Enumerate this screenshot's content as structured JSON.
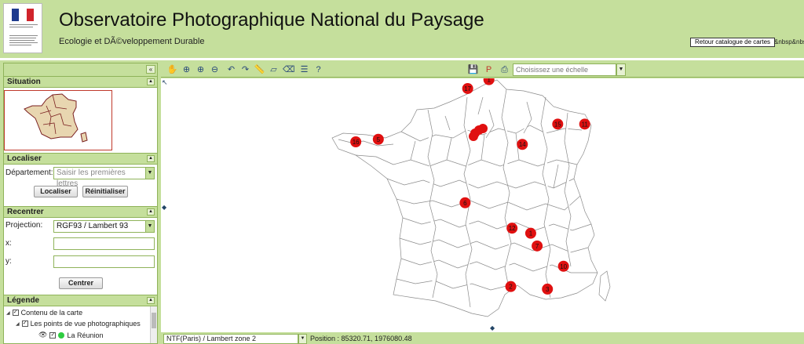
{
  "header": {
    "title": "Observatoire Photographique National du Paysage",
    "subtitle": "Ecologie et DÃ©veloppement Durable",
    "back_button": "Retour catalogue de cartes",
    "back_trail": "&nbsp&nbs",
    "logo_text": "RÉPUBLIQUE FRANÇAISE"
  },
  "panel": {
    "situation": {
      "title": "Situation"
    },
    "localiser": {
      "title": "Localiser",
      "departement_label": "Département:",
      "departement_placeholder": "Saisir les premières lettres",
      "localiser_button": "Localiser",
      "reset_button": "Réinitialiser"
    },
    "recentrer": {
      "title": "Recentrer",
      "projection_label": "Projection:",
      "projection_value": "RGF93 / Lambert 93",
      "x_label": "x:",
      "y_label": "y:",
      "center_button": "Centrer"
    },
    "legende": {
      "title": "Légende",
      "items": [
        "Contenu de la carte",
        "Les points de vue photographiques",
        "La Réunion"
      ]
    }
  },
  "toolbar": {
    "scale_placeholder": "Choisissez une échelle",
    "icons": [
      "pan-icon",
      "zoom-extent-icon",
      "zoom-in-icon",
      "zoom-out-icon",
      "previous-view-icon",
      "next-view-icon",
      "measure-distance-icon",
      "measure-area-icon",
      "clear-measure-icon",
      "legend-list-icon",
      "query-icon",
      "save-icon",
      "pdf-icon",
      "print-icon",
      "export-icon",
      "map-info-icon"
    ]
  },
  "map": {
    "markers": [
      {
        "label": "17",
        "x": 0.477,
        "y": 0.04
      },
      {
        "label": "1",
        "x": 0.51,
        "y": 0.005
      },
      {
        "label": "16",
        "x": 0.303,
        "y": 0.25
      },
      {
        "label": "5",
        "x": 0.338,
        "y": 0.24
      },
      {
        "label": "15",
        "x": 0.617,
        "y": 0.18
      },
      {
        "label": "11",
        "x": 0.659,
        "y": 0.18
      },
      {
        "label": "14",
        "x": 0.562,
        "y": 0.26
      },
      {
        "label": "6",
        "x": 0.473,
        "y": 0.49
      },
      {
        "label": "12",
        "x": 0.546,
        "y": 0.59
      },
      {
        "label": "1",
        "x": 0.575,
        "y": 0.61
      },
      {
        "label": "7",
        "x": 0.585,
        "y": 0.66
      },
      {
        "label": "10",
        "x": 0.626,
        "y": 0.74
      },
      {
        "label": "2",
        "x": 0.544,
        "y": 0.82
      },
      {
        "label": "3",
        "x": 0.601,
        "y": 0.83
      }
    ]
  },
  "status": {
    "projection": "NTF(Paris) / Lambert zone 2",
    "position": "Position : 85320.71, 1976080.48"
  },
  "colors": {
    "header_bg": "#c5df9c",
    "border": "#8fb35a",
    "marker": "#e01010"
  }
}
